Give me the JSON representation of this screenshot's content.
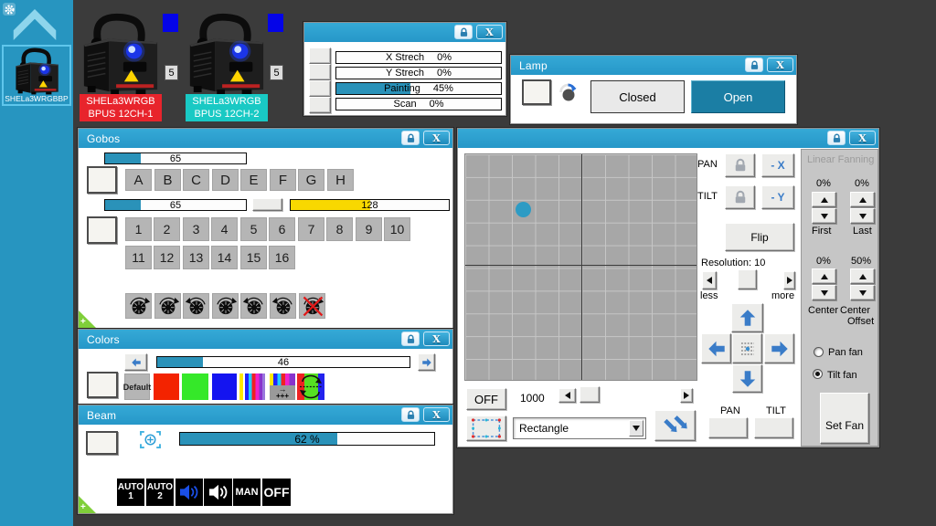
{
  "ui": {
    "close": "X",
    "plus": "+"
  },
  "theme_colors": {
    "titlebar": "#2a9fd0",
    "sidebar": "#2795c0",
    "slider_fill": "#2a92b9",
    "yellow_fill": "#f8d800",
    "open_button": "#1b7ea4",
    "fixture1_label_bg": "#e8242c",
    "fixture2_label_bg": "#19c9c4",
    "arrow_blue": "#3a7cc8",
    "background": "#3b3b3b"
  },
  "sidebar": {
    "fixture_label": "SHELa3WRGBBP"
  },
  "fixtures": {
    "items": [
      {
        "line1": "SHELa3WRGB",
        "line2": "BPUS 12CH-1",
        "badge": "5"
      },
      {
        "line1": "SHELa3WRGB",
        "line2": "BPUS 12CH-2",
        "badge": "5"
      }
    ]
  },
  "strech": {
    "rows": [
      {
        "label": "X Strech",
        "value": "0%",
        "fill": 0
      },
      {
        "label": "Y Strech",
        "value": "0%",
        "fill": 0
      },
      {
        "label": "Painting",
        "value": "45%",
        "fill": 45
      },
      {
        "label": "Scan",
        "value": "0%",
        "fill": 0
      }
    ]
  },
  "lamp": {
    "title": "Lamp",
    "closed": "Closed",
    "open": "Open"
  },
  "gobos": {
    "title": "Gobos",
    "top_slider": {
      "value": "65",
      "fill": 25
    },
    "mid_slider": {
      "value": "65",
      "fill": 25
    },
    "yellow_slider": {
      "value": "128",
      "fill": 50
    },
    "letters": [
      "A",
      "B",
      "C",
      "D",
      "E",
      "F",
      "G",
      "H"
    ],
    "numbers": [
      "1",
      "2",
      "3",
      "4",
      "5",
      "6",
      "7",
      "8",
      "9",
      "10",
      "11",
      "12",
      "13",
      "14",
      "15",
      "16"
    ]
  },
  "colors": {
    "title": "Colors",
    "slider": {
      "value": "46",
      "fill": 18
    },
    "default_label": "Default",
    "plus_label": "+++",
    "arrow_label": "→"
  },
  "beam": {
    "title": "Beam",
    "slider": {
      "value": "62 %",
      "fill": 62
    },
    "auto1_top": "AUTO",
    "auto1_bottom": "1",
    "auto2_top": "AUTO",
    "auto2_bottom": "2",
    "man": "MAN",
    "off": "OFF"
  },
  "position": {
    "pan": "PAN",
    "tilt": "TILT",
    "minus_x": "- X",
    "minus_y": "- Y",
    "flip": "Flip",
    "resolution": "Resolution: 10",
    "less": "less",
    "more": "more",
    "off": "OFF",
    "speed": "1000",
    "shape": "Rectangle",
    "pan2": "PAN",
    "tilt2": "TILT"
  },
  "fanning": {
    "title": "Linear Fanning",
    "first_value": "0%",
    "last_value": "0%",
    "first": "First",
    "last": "Last",
    "center_value": "0%",
    "center_offset_value": "50%",
    "center": "Center",
    "center2": "Center",
    "offset": "Offset",
    "pan_fan": "Pan fan",
    "tilt_fan": "Tilt fan",
    "set_fan": "Set Fan"
  }
}
